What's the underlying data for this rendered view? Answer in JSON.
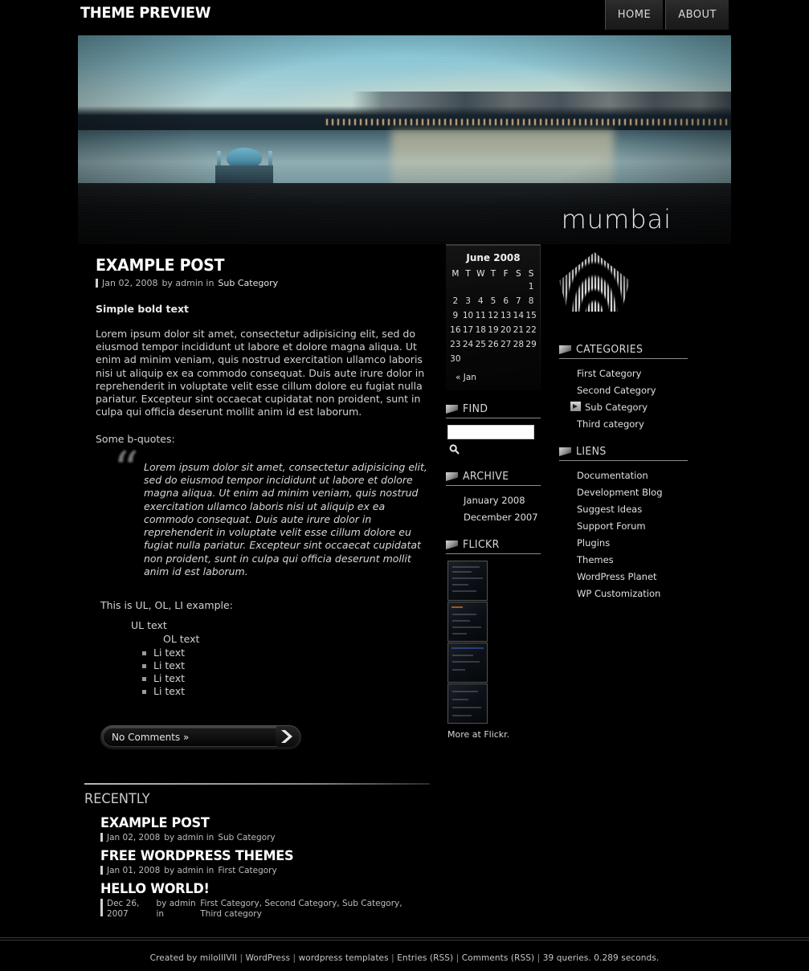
{
  "header": {
    "site_title": "THEME PREVIEW",
    "nav": [
      {
        "label": "HOME"
      },
      {
        "label": "ABOUT"
      }
    ],
    "banner_wordmark": "mumbai"
  },
  "post": {
    "title": "EXAMPLE POST",
    "meta_date": "Jan 02, 2008",
    "meta_by": "by admin in",
    "meta_category": "Sub Category",
    "bold_text": "Simple bold text",
    "paragraph": "Lorem ipsum dolor sit amet, consectetur adipisicing elit, sed do eiusmod tempor incididunt ut labore et dolore magna aliqua. Ut enim ad minim veniam, quis nostrud exercitation ullamco laboris nisi ut aliquip ex ea commodo consequat. Duis aute irure dolor in reprehenderit in voluptate velit esse cillum dolore eu fugiat nulla pariatur. Excepteur sint occaecat cupidatat non proident, sunt in culpa qui officia deserunt mollit anim id est laborum.",
    "bquote_intro": "Some b-quotes:",
    "blockquote": "Lorem ipsum dolor sit amet, consectetur adipisicing elit, sed do eiusmod tempor incididunt ut labore et dolore magna aliqua. Ut enim ad minim veniam, quis nostrud exercitation ullamco laboris nisi ut aliquip ex ea commodo consequat. Duis aute irure dolor in reprehenderit in voluptate velit esse cillum dolore eu fugiat nulla pariatur. Excepteur sint occaecat cupidatat non proident, sunt in culpa qui officia deserunt mollit anim id est laborum.",
    "quote_mark": "“",
    "list_intro": "This is UL, OL, LI example:",
    "ul_text": "UL text",
    "ol_text": "OL text",
    "li_items": [
      "Li text",
      "Li text",
      "Li text",
      "Li text"
    ],
    "comments_label": "No Comments »"
  },
  "calendar": {
    "caption": "June 2008",
    "weekdays": [
      "M",
      "T",
      "W",
      "T",
      "F",
      "S",
      "S"
    ],
    "weeks": [
      [
        "",
        "",
        "",
        "",
        "",
        "",
        "1"
      ],
      [
        "2",
        "3",
        "4",
        "5",
        "6",
        "7",
        "8"
      ],
      [
        "9",
        "10",
        "11",
        "12",
        "13",
        "14",
        "15"
      ],
      [
        "16",
        "17",
        "18",
        "19",
        "20",
        "21",
        "22"
      ],
      [
        "23",
        "24",
        "25",
        "26",
        "27",
        "28",
        "29"
      ],
      [
        "30",
        "",
        "",
        "",
        "",
        "",
        ""
      ]
    ],
    "prev_label": "« Jan"
  },
  "find_widget": {
    "title": "FIND",
    "input_value": "",
    "input_placeholder": "",
    "search_icon": "magnifier-icon"
  },
  "archive_widget": {
    "title": "ARCHIVE",
    "items": [
      "January 2008",
      "December 2007"
    ]
  },
  "flickr_widget": {
    "title": "FLICKR",
    "thumbs": [
      "flickr-thumb-1",
      "flickr-thumb-2",
      "flickr-thumb-3",
      "flickr-thumb-4"
    ],
    "more_label": "More at Flickr."
  },
  "categories_widget": {
    "title": "CATEGORIES",
    "items": [
      {
        "label": "First Category",
        "sub": false
      },
      {
        "label": "Second Category",
        "sub": false
      },
      {
        "label": "Sub Category",
        "sub": true
      },
      {
        "label": "Third category",
        "sub": false
      }
    ]
  },
  "liens_widget": {
    "title": "LIENS",
    "items": [
      "Documentation",
      "Development Blog",
      "Suggest Ideas",
      "Support Forum",
      "Plugins",
      "Themes",
      "WordPress Planet",
      "WP Customization"
    ]
  },
  "recently": {
    "title": "RECENTLY",
    "items": [
      {
        "title": "EXAMPLE POST",
        "date": "Jan 02, 2008",
        "by": "by admin in",
        "categories": "Sub Category"
      },
      {
        "title": "FREE WORDPRESS THEMES",
        "date": "Jan 01, 2008",
        "by": "by admin in",
        "categories": "First Category"
      },
      {
        "title": "HELLO WORLD!",
        "date": "Dec 26, 2007",
        "by": "by admin in",
        "categories": "First Category, Second Category, Sub Category, Third category"
      }
    ]
  },
  "footer": {
    "created_by": "Created by miloIIIVII",
    "links": [
      "WordPress",
      "wordpress templates",
      "Entries (RSS)",
      "Comments (RSS)"
    ],
    "stats": "39 queries. 0.289 seconds.",
    "separator": " | "
  },
  "colors": {
    "page_background": "#000000",
    "text_primary": "#ffffff",
    "text_secondary": "#d2d2d2",
    "text_muted": "#bdbdbd",
    "rule": "#8d8d8d"
  }
}
